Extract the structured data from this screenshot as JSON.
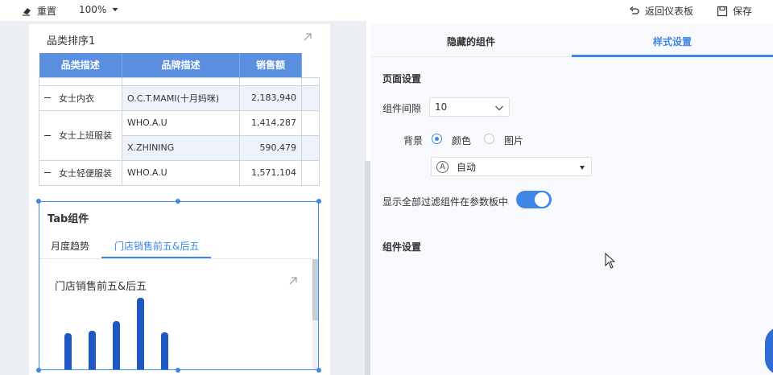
{
  "toolbar": {
    "reset_label": "重置",
    "zoom_value": "100%",
    "back_label": "返回仪表板",
    "save_label": "保存"
  },
  "table_card": {
    "title": "品类排序1",
    "headers": [
      "品类描述",
      "品牌描述",
      "销售额"
    ],
    "rows": [
      {
        "category": "女士内衣",
        "brand": "O.C.T.MAMI(十月妈咪)",
        "sales": "2,183,940"
      },
      {
        "category": "女士上班服装",
        "brand": "WHO.A.U",
        "sales": "1,414,287"
      },
      {
        "category": "",
        "brand": "X.ZHINING",
        "sales": "590,479"
      },
      {
        "category": "女士轻便服装",
        "brand": "WHO.A.U",
        "sales": "1,571,104"
      }
    ]
  },
  "tab_widget": {
    "title": "Tab组件",
    "tabs": [
      {
        "label": "月度趋势",
        "active": false
      },
      {
        "label": "门店销售前五&后五",
        "active": true
      }
    ]
  },
  "chart_data": {
    "type": "bar",
    "title": "门店销售前五&后五",
    "values": [
      43,
      45,
      57,
      84,
      44
    ],
    "ylim": [
      0,
      90
    ]
  },
  "right_panel": {
    "tabs": [
      {
        "label": "隐藏的组件",
        "active": false
      },
      {
        "label": "样式设置",
        "active": true
      }
    ],
    "page_settings_title": "页面设置",
    "gap_label": "组件间隙",
    "gap_value": "10",
    "background_label": "背景",
    "color_option": "颜色",
    "image_option": "图片",
    "auto_badge": "A",
    "auto_value": "自动",
    "show_filters_label": "显示全部过滤组件在参数板中",
    "show_filters_on": true,
    "component_settings_title": "组件设置"
  },
  "colors": {
    "accent": "#3f86e8",
    "table_header": "#5a8fe0",
    "bar": "#1f58c2"
  }
}
